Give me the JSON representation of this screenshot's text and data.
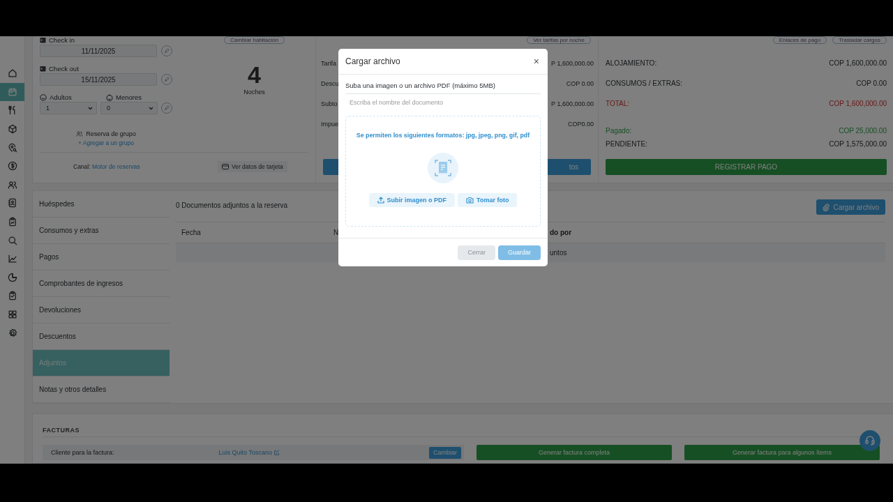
{
  "sidebar": {
    "items": [
      {
        "kind": "home",
        "selected": false
      },
      {
        "kind": "calendar",
        "selected": true
      },
      {
        "kind": "utensils",
        "selected": false
      },
      {
        "kind": "box",
        "selected": false
      },
      {
        "kind": "location",
        "selected": false
      },
      {
        "kind": "dollar",
        "selected": false
      },
      {
        "kind": "users",
        "selected": false
      },
      {
        "kind": "contacts",
        "selected": false
      },
      {
        "kind": "clipboard",
        "selected": false
      },
      {
        "kind": "search",
        "selected": false
      },
      {
        "kind": "chart",
        "selected": false
      },
      {
        "kind": "pie",
        "selected": false
      },
      {
        "kind": "checklist",
        "selected": false
      },
      {
        "kind": "grid",
        "selected": false
      },
      {
        "kind": "settings",
        "selected": false
      }
    ]
  },
  "reservation": {
    "check_in": {
      "label": "Check in",
      "value": "11/11/2025"
    },
    "check_out": {
      "label": "Check out",
      "value": "15/11/2025"
    },
    "adults": {
      "label": "Adultos",
      "value": "1"
    },
    "minors": {
      "label": "Menores",
      "value": "0"
    },
    "change_room": "Cambiar habitación",
    "nights": {
      "count": "4",
      "label": "Noches"
    },
    "group": {
      "label": "Reserva de grupo",
      "link": "+ Agregar a un grupo"
    },
    "channel": {
      "label": "Canal:",
      "value": "Motor de reservas"
    },
    "card_button": "Ver datos de tarjeta"
  },
  "rates": {
    "button": "Ver tarifas por noche",
    "rows": [
      {
        "label": "Tarifa",
        "value": "P 1,600,000.00"
      },
      {
        "label": "Descu",
        "value": "COP 0.00"
      },
      {
        "label": "Subto",
        "value": "P 1,600,000.00"
      },
      {
        "label": "Impue",
        "value": "COP0.00"
      }
    ],
    "action": "tos"
  },
  "totals": {
    "buttons": [
      "Enlaces de pago",
      "Trasladar cargos"
    ],
    "rows": [
      {
        "label": "ALOJAMIENTO:",
        "value": "COP 1,600,000.00",
        "kind": "normal"
      },
      {
        "label": "CONSUMOS / EXTRAS:",
        "value": "COP 0.00",
        "kind": "normal"
      },
      {
        "label": "TOTAL:",
        "value": "COP 1,600,000.00",
        "kind": "total"
      },
      {
        "label": "Pagado:",
        "value": "COP 25,000.00",
        "kind": "paid"
      },
      {
        "label": "PENDIENTE:",
        "value": "COP 1,575,000.00",
        "kind": "normal"
      }
    ],
    "action": "REGISTRAR PAGO"
  },
  "tabs": [
    {
      "label": "Huéspedes",
      "selected": false
    },
    {
      "label": "Consumos y extras",
      "selected": false
    },
    {
      "label": "Pagos",
      "selected": false
    },
    {
      "label": "Comprobantes de ingresos",
      "selected": false
    },
    {
      "label": "Devoluciones",
      "selected": false
    },
    {
      "label": "Descuentos",
      "selected": false
    },
    {
      "label": "Adjuntos",
      "selected": true
    },
    {
      "label": "Notas y otros detalles",
      "selected": false
    }
  ],
  "attachments": {
    "count_text": "0 Documentos adjuntos a la reserva",
    "upload_button": "Cargar archivo",
    "columns": [
      "Fecha",
      "N",
      "do por"
    ],
    "empty_text": "untos"
  },
  "invoices": {
    "title": "FACTURAS",
    "client_label": "Cliente para la factura:",
    "client_name": "Luis Quito Toscano",
    "change_button": "Cambiar",
    "actions": [
      "Generar factura completa",
      "Generar factura para algunos ítems"
    ]
  },
  "modal": {
    "title": "Cargar archivo",
    "close": "×",
    "instruction": "Suba una imagen o un archivo PDF (máximo 5MB)",
    "name_placeholder": "Escriba el nombre del documento",
    "formats": "Se permiten los siguientes formatos: jpg, jpeg, png, gif, pdf",
    "upload_button": "Subir imagen o PDF",
    "photo_button": "Tomar foto",
    "buttons": [
      {
        "label": "Cerrar",
        "kind": "secondary",
        "disabled": false
      },
      {
        "label": "Guardar",
        "kind": "primary",
        "disabled": true
      }
    ]
  }
}
